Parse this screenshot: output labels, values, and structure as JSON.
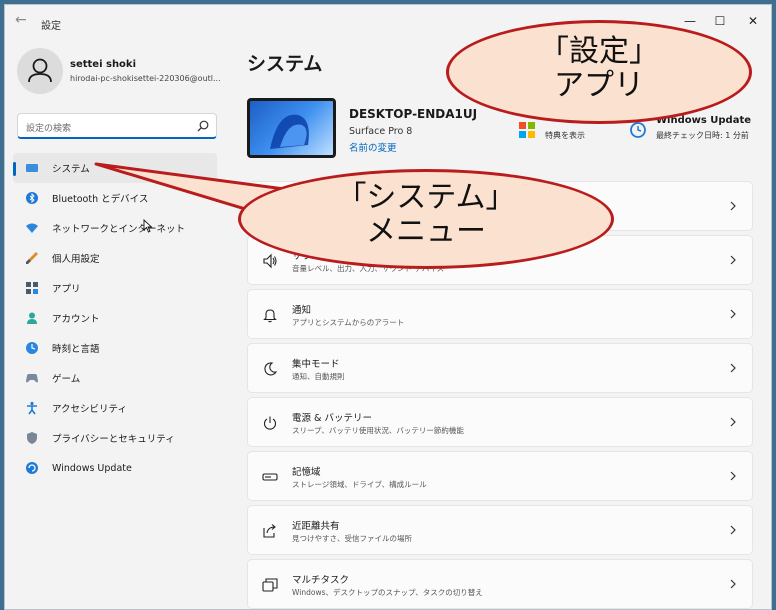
{
  "window": {
    "title": "設定",
    "back_label": "←",
    "minimize_label": "—",
    "maximize_label": "☐",
    "close_label": "✕"
  },
  "user": {
    "name": "settei shoki",
    "email": "hirodai-pc-shokisettei-220306@outl..."
  },
  "search": {
    "placeholder": "設定の検索"
  },
  "sidebar": {
    "items": [
      {
        "label": "システム",
        "icon": "display-icon",
        "active": true
      },
      {
        "label": "Bluetooth とデバイス",
        "icon": "bluetooth-icon"
      },
      {
        "label": "ネットワークとインターネット",
        "icon": "wifi-icon"
      },
      {
        "label": "個人用設定",
        "icon": "brush-icon"
      },
      {
        "label": "アプリ",
        "icon": "apps-icon"
      },
      {
        "label": "アカウント",
        "icon": "person-icon"
      },
      {
        "label": "時刻と言語",
        "icon": "globe-clock-icon"
      },
      {
        "label": "ゲーム",
        "icon": "gamepad-icon"
      },
      {
        "label": "アクセシビリティ",
        "icon": "accessibility-icon"
      },
      {
        "label": "プライバシーとセキュリティ",
        "icon": "shield-icon"
      },
      {
        "label": "Windows Update",
        "icon": "windows-update-icon"
      }
    ]
  },
  "main": {
    "page_title": "システム",
    "device": {
      "name": "DESKTOP-ENDA1UJ",
      "model": "Surface Pro 8",
      "rename_link": "名前の変更"
    },
    "microsoft365": {
      "label": "特典を表示"
    },
    "windows_update": {
      "title": "Windows Update",
      "subtitle": "最終チェック日時: 1 分前"
    },
    "cards": [
      {
        "title": "",
        "subtitle": "",
        "icon": "display-icon"
      },
      {
        "title": "サウンド",
        "subtitle": "音量レベル、出力、入力、サウンド デバイス",
        "icon": "speaker-icon"
      },
      {
        "title": "通知",
        "subtitle": "アプリとシステムからのアラート",
        "icon": "bell-icon"
      },
      {
        "title": "集中モード",
        "subtitle": "通知、自動規則",
        "icon": "moon-icon"
      },
      {
        "title": "電源 & バッテリー",
        "subtitle": "スリープ、バッテリ使用状況、バッテリー節約機能",
        "icon": "power-icon"
      },
      {
        "title": "記憶域",
        "subtitle": "ストレージ領域、ドライブ、構成ルール",
        "icon": "storage-icon"
      },
      {
        "title": "近距離共有",
        "subtitle": "見つけやすさ、受信ファイルの場所",
        "icon": "share-icon"
      },
      {
        "title": "マルチタスク",
        "subtitle": "Windows、デスクトップのスナップ、タスクの切り替え",
        "icon": "multitask-icon"
      }
    ]
  },
  "callouts": {
    "settings_app": {
      "line1": "「設定」",
      "line2": "アプリ"
    },
    "system_menu": {
      "line1": "「システム」",
      "line2": "メニュー"
    }
  },
  "colors": {
    "accent": "#0067c0",
    "callout_fill": "#fbe1cf",
    "callout_border": "#b81c1c"
  }
}
